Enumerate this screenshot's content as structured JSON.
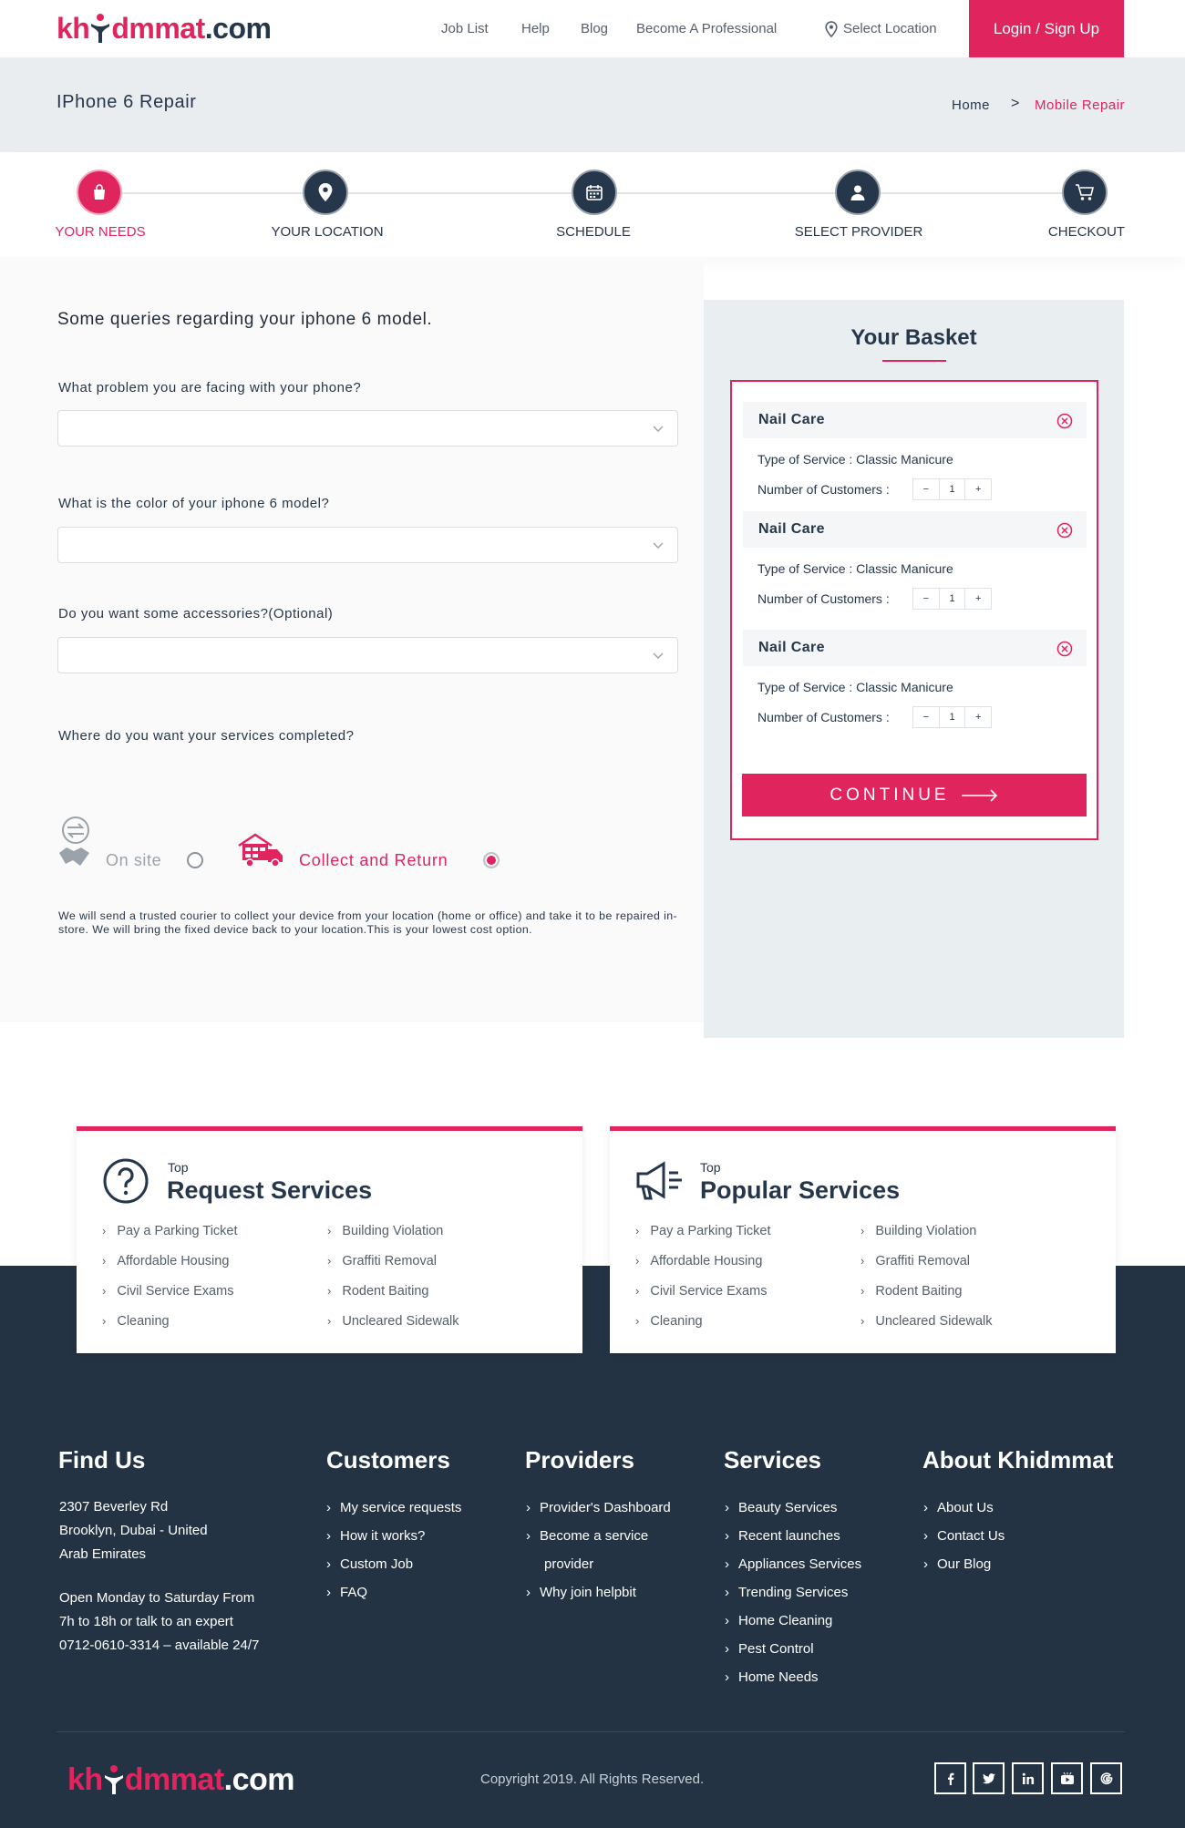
{
  "header": {
    "logo": {
      "part1": "kh",
      "part2": "dmmat",
      "part3": ".com"
    },
    "nav": [
      "Job List",
      "Help",
      "Blog",
      "Become A Professional"
    ],
    "location_label": "Select Location",
    "login_label": "Login / Sign Up"
  },
  "banner": {
    "title": "IPhone 6 Repair",
    "breadcrumb": {
      "home": "Home",
      "separator": ">",
      "current": "Mobile Repair"
    }
  },
  "steps": [
    {
      "label": "YOUR NEEDS",
      "icon": "shopping-bag-icon",
      "active": true
    },
    {
      "label": "YOUR LOCATION",
      "icon": "map-pin-icon",
      "active": false
    },
    {
      "label": "SCHEDULE",
      "icon": "calendar-icon",
      "active": false
    },
    {
      "label": "SELECT PROVIDER",
      "icon": "provider-icon",
      "active": false
    },
    {
      "label": "CHECKOUT",
      "icon": "cart-icon",
      "active": false
    }
  ],
  "form": {
    "title": "Some queries regarding your iphone 6 model.",
    "q1": "What problem you are facing with your phone?",
    "q2": "What is the color of  your iphone 6 model?",
    "q3": "Do you want some accessories?(Optional)",
    "q4": "Where do you want your services completed?",
    "select_values": [
      "",
      "",
      ""
    ],
    "options": {
      "onsite": {
        "label": "On site",
        "selected": false
      },
      "collect": {
        "label": "Collect and Return",
        "selected": true
      }
    },
    "note": "We will send a trusted courier to collect your device from your location (home or office) and take it to be repaired in-store. We will bring the fixed device back to your location.This is your lowest cost option."
  },
  "basket": {
    "title": "Your Basket",
    "type_label": "Type of Service :",
    "count_label": "Number of Customers :",
    "items": [
      {
        "name": "Nail Care",
        "type": "Classic Manicure",
        "qty": "1"
      },
      {
        "name": "Nail Care",
        "type": "Classic Manicure",
        "qty": "1"
      },
      {
        "name": "Nail Care",
        "type": "Classic Manicure",
        "qty": "1"
      }
    ],
    "minus": "−",
    "plus": "+",
    "continue_label": "CONTINUE"
  },
  "services": {
    "request": {
      "top": "Top",
      "title": "Request Services",
      "col1": [
        "Pay a Parking Ticket",
        "Affordable Housing",
        "Civil Service Exams",
        "Cleaning"
      ],
      "col2": [
        "Building Violation",
        "Graffiti Removal",
        "Rodent Baiting",
        "Uncleared Sidewalk"
      ]
    },
    "popular": {
      "top": "Top",
      "title": "Popular Services",
      "col1": [
        "Pay a Parking Ticket",
        "Affordable Housing",
        "Civil Service Exams",
        "Cleaning"
      ],
      "col2": [
        "Building Violation",
        "Graffiti Removal",
        "Rodent Baiting",
        "Uncleared Sidewalk"
      ]
    }
  },
  "footer": {
    "find_us": {
      "title": "Find Us",
      "address": [
        "2307 Beverley Rd",
        "Brooklyn, Dubai - United",
        "Arab Emirates"
      ],
      "hours": [
        "Open Monday to Saturday From",
        "7h to 18h or talk to an expert",
        "0712-0610-3314 – available 24/7"
      ]
    },
    "customers": {
      "title": "Customers",
      "links": [
        "My service requests",
        "How it works?",
        "Custom Job",
        "FAQ"
      ]
    },
    "providers": {
      "title": "Providers",
      "links": [
        "Provider's Dashboard",
        "Become a service",
        "provider",
        "Why join helpbit"
      ]
    },
    "services": {
      "title": "Services",
      "links": [
        "Beauty Services",
        "Recent launches",
        "Appliances Services",
        "Trending Services",
        "Home Cleaning",
        "Pest Control",
        "Home Needs"
      ]
    },
    "about": {
      "title": "About Khidmmat",
      "links": [
        "About Us",
        "Contact Us",
        "Our Blog"
      ]
    },
    "copyright": "Copyright 2019. All Rights Reserved.",
    "social": [
      {
        "icon": "facebook-icon",
        "glyph": "f"
      },
      {
        "icon": "twitter-icon",
        "glyph": "t"
      },
      {
        "icon": "linkedin-icon",
        "glyph": "in"
      },
      {
        "icon": "youtube-icon",
        "glyph": "▶"
      },
      {
        "icon": "google-icon",
        "glyph": "G"
      }
    ]
  }
}
